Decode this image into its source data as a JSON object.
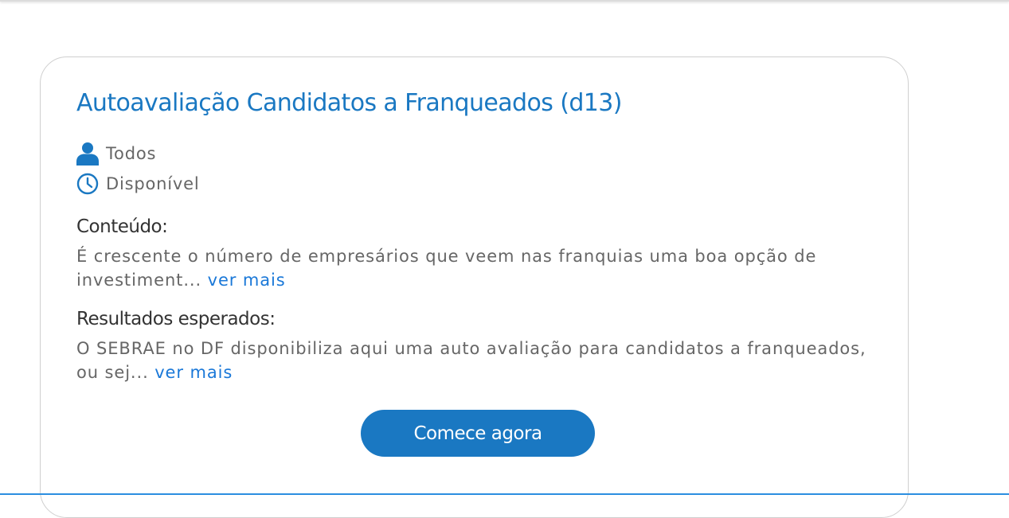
{
  "card": {
    "title": "Autoavaliação Candidatos a Franqueados (d13)",
    "audience": {
      "icon": "user-icon",
      "label": "Todos"
    },
    "availability": {
      "icon": "clock-icon",
      "label": "Disponível"
    },
    "content": {
      "label": "Conteúdo:",
      "text": "É crescente o número de empresários que veem nas franquias uma boa opção de investiment...",
      "see_more": "ver mais"
    },
    "results": {
      "label": "Resultados esperados:",
      "text": "O SEBRAE no DF disponibiliza aqui uma auto avaliação para candidatos a franqueados, ou sej...",
      "see_more": "ver mais"
    },
    "cta_label": "Comece agora"
  },
  "colors": {
    "primary": "#1a78c2",
    "link": "#1a78d8",
    "text_muted": "#666666",
    "text_dark": "#333333",
    "border": "#cfcfcf"
  }
}
